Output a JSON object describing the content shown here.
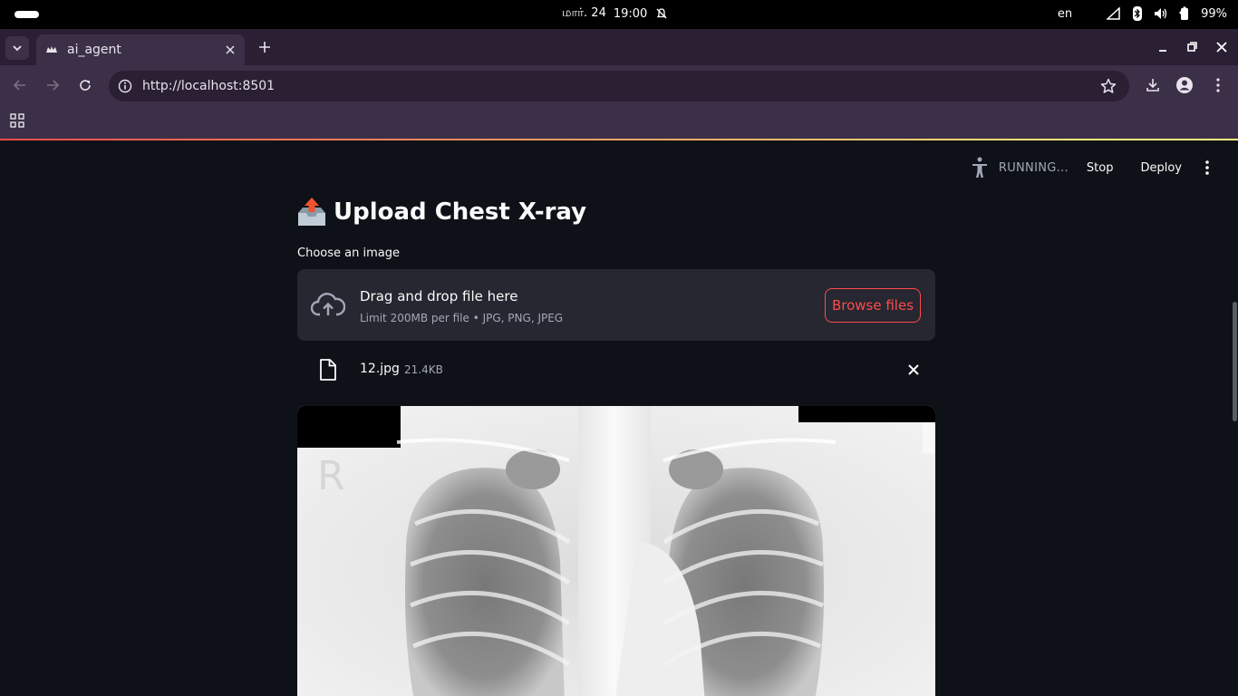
{
  "system_bar": {
    "date": "மார். 24",
    "time": "19:00",
    "language": "en",
    "battery": "99%"
  },
  "browser": {
    "tab_title": "ai_agent",
    "url": "http://localhost:8501"
  },
  "app": {
    "status_text": "RUNNING...",
    "stop_label": "Stop",
    "deploy_label": "Deploy",
    "title": "Upload Chest X-ray",
    "uploader_label": "Choose an image",
    "dropzone_main": "Drag and drop file here",
    "dropzone_sub": "Limit 200MB per file • JPG, PNG, JPEG",
    "browse_label": "Browse files",
    "file_name": "12.jpg",
    "file_size": "21.4KB",
    "xray_marker": "R"
  },
  "colors": {
    "accent": "#ff4b4b",
    "background": "#0e1117",
    "dropzone_bg": "#262730",
    "browser_chrome": "#3b3047"
  }
}
